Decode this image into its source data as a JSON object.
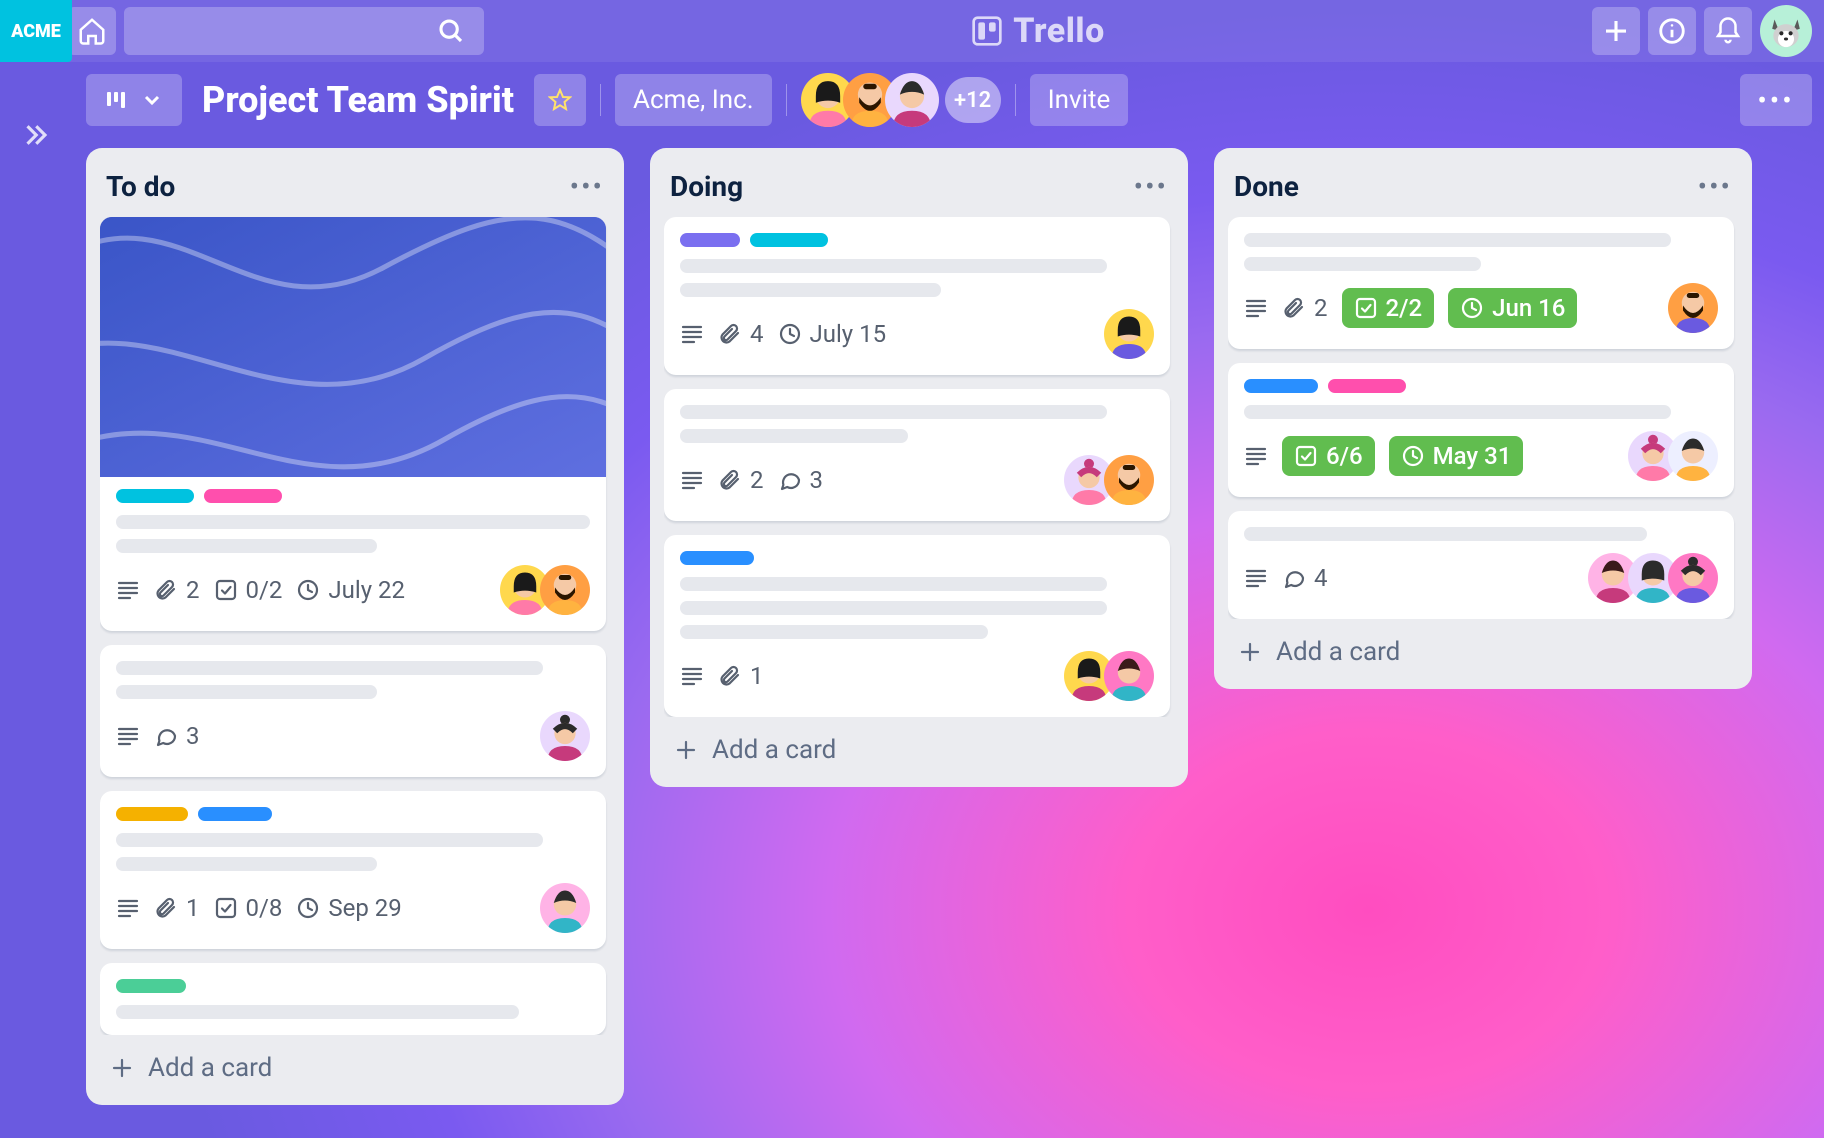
{
  "brand": "Trello",
  "workspace_badge": "ACME",
  "board": {
    "title": "Project Team Spirit",
    "org": "Acme, Inc.",
    "extra_members": "+12",
    "invite": "Invite"
  },
  "colors": {
    "teal": "#00C2E0",
    "pink": "#FF4FAD",
    "purple": "#7A6FF0",
    "blue": "#298FFF",
    "yellow": "#F5B100",
    "green": "#4BCE97",
    "badge_green": "#61BD4F"
  },
  "lists": [
    {
      "title": "To do",
      "add": "Add a card",
      "cards": [
        {
          "cover": true,
          "labels": [
            "teal",
            "pink"
          ],
          "skel": [
            1.0,
            0.55
          ],
          "badges": {
            "description": true,
            "attachments": 2,
            "checklist": "0/2",
            "due": "July 22"
          },
          "members": [
            "a1",
            "a2"
          ]
        },
        {
          "labels": [],
          "skel": [
            0.9,
            0.55
          ],
          "badges": {
            "description": true,
            "comments": 3
          },
          "members": [
            "a3"
          ]
        },
        {
          "labels": [
            "yellow",
            "blue"
          ],
          "skel": [
            0.9,
            0.55
          ],
          "badges": {
            "description": true,
            "attachments": 1,
            "checklist": "0/8",
            "due": "Sep 29"
          },
          "members": [
            "a4"
          ]
        },
        {
          "labels": [
            "green"
          ],
          "skel": [
            0.85
          ],
          "badges": {},
          "members": []
        }
      ]
    },
    {
      "title": "Doing",
      "add": "Add a card",
      "cards": [
        {
          "labels": [
            "purple",
            "teal"
          ],
          "skel": [
            0.9,
            0.55
          ],
          "badges": {
            "description": true,
            "attachments": 4,
            "due": "July 15"
          },
          "members": [
            "a5"
          ]
        },
        {
          "labels": [],
          "skel": [
            0.9,
            0.48
          ],
          "badges": {
            "description": true,
            "comments": 3,
            "attachments": 2
          },
          "members": [
            "a6",
            "a7"
          ]
        },
        {
          "labels": [
            "blue"
          ],
          "skel": [
            0.9,
            0.9,
            0.65
          ],
          "badges": {
            "description": true,
            "attachments": 1
          },
          "members": [
            "a8",
            "a9"
          ]
        }
      ]
    },
    {
      "title": "Done",
      "add": "Add a card",
      "cards": [
        {
          "labels": [],
          "skel": [
            0.9,
            0.5
          ],
          "badges": {
            "description": true,
            "attachments": 2,
            "checklist_done": "2/2",
            "due_done": "Jun 16"
          },
          "members": [
            "a10"
          ]
        },
        {
          "labels": [
            "blue",
            "pink"
          ],
          "skel": [
            0.9
          ],
          "badges": {
            "description": true,
            "checklist_done": "6/6",
            "due_done": "May 31"
          },
          "members": [
            "a11",
            "a12"
          ]
        },
        {
          "labels": [],
          "skel": [
            0.85
          ],
          "badges": {
            "description": true,
            "comments": 4
          },
          "members": [
            "a13",
            "a14",
            "a15"
          ]
        }
      ]
    }
  ],
  "avatars": {
    "a1": {
      "bg": "#FFD84D",
      "fg": "#1a1a1a",
      "type": "bob"
    },
    "a2": {
      "bg": "#FF9F43",
      "fg": "#2b1600",
      "type": "beard"
    },
    "a3": {
      "bg": "#E9D8FD",
      "fg": "#2b2b2b",
      "type": "bun"
    },
    "a4": {
      "bg": "#FFB3E6",
      "fg": "#2b2b2b",
      "type": "short"
    },
    "a5": {
      "bg": "#FFD84D",
      "fg": "#1a1a1a",
      "type": "bob"
    },
    "a6": {
      "bg": "#E9D8FD",
      "fg": "#c63a7c",
      "type": "bun"
    },
    "a7": {
      "bg": "#FF9F43",
      "fg": "#2b1600",
      "type": "beard"
    },
    "a8": {
      "bg": "#FFD84D",
      "fg": "#1a1a1a",
      "type": "bob"
    },
    "a9": {
      "bg": "#FF78C4",
      "fg": "#3a1a1a",
      "type": "short"
    },
    "a10": {
      "bg": "#FF9F43",
      "fg": "#2b1600",
      "type": "beard"
    },
    "a11": {
      "bg": "#E9D8FD",
      "fg": "#c63a7c",
      "type": "bun"
    },
    "a12": {
      "bg": "#EDEFFF",
      "fg": "#2b2b2b",
      "type": "short"
    },
    "a13": {
      "bg": "#FFB3E6",
      "fg": "#3a1a1a",
      "type": "short"
    },
    "a14": {
      "bg": "#E9D8FD",
      "fg": "#2b2b2b",
      "type": "bob"
    },
    "a15": {
      "bg": "#FF78C4",
      "fg": "#2b2b2b",
      "type": "bun"
    },
    "h1": {
      "bg": "#FFD84D",
      "fg": "#1a1a1a",
      "type": "bob"
    },
    "h2": {
      "bg": "#FF9F43",
      "fg": "#2b1600",
      "type": "beard"
    },
    "h3": {
      "bg": "#E9D8FD",
      "fg": "#2b2b2b",
      "type": "short"
    }
  }
}
